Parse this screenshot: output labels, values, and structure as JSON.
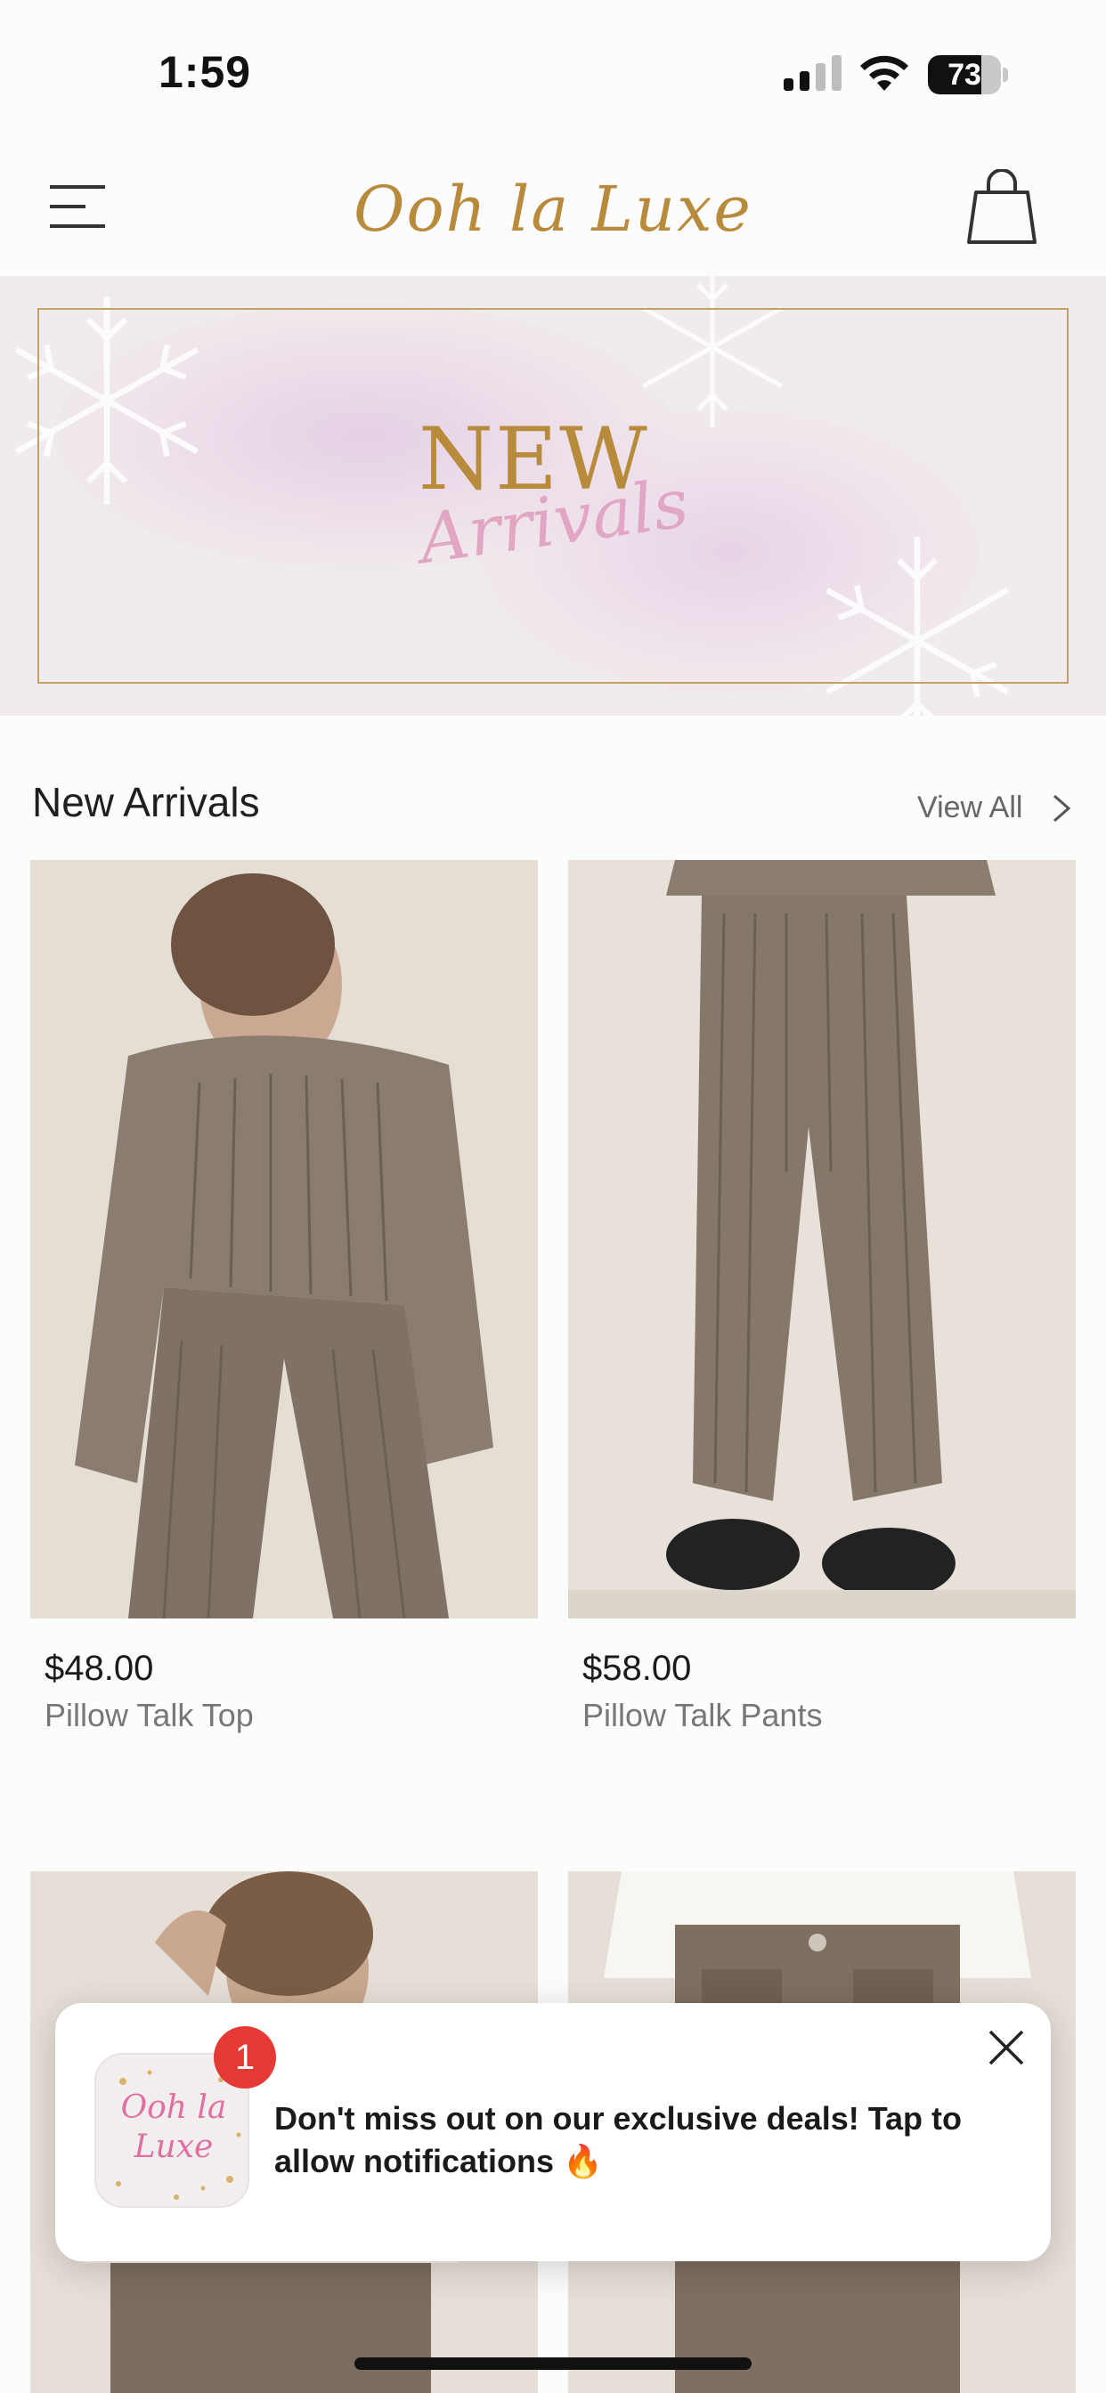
{
  "status_bar": {
    "time": "1:59",
    "battery_level": "73",
    "battery_fraction": 0.73,
    "icons": [
      "signal-icon",
      "wifi-icon",
      "battery-icon"
    ]
  },
  "nav": {
    "logo_text": "Ooh la Luxe",
    "menu_icon": "hamburger-icon",
    "bag_icon": "shopping-bag-icon"
  },
  "banner": {
    "line1": "NEW",
    "line2": "Arrivals"
  },
  "section": {
    "title": "New Arrivals",
    "view_all": "View All"
  },
  "products": [
    {
      "price": "$48.00",
      "name": "Pillow Talk Top"
    },
    {
      "price": "$58.00",
      "name": "Pillow Talk Pants"
    },
    {
      "price": "",
      "name": ""
    },
    {
      "price": "",
      "name": ""
    }
  ],
  "notification": {
    "badge_count": "1",
    "app_icon_text": "Ooh la Luxe",
    "message": "Don't miss out on our exclusive deals! Tap to allow notifications 🔥",
    "close_icon": "close-icon"
  },
  "colors": {
    "accent_gold": "#b88a3b",
    "accent_pink": "#e1a7c2",
    "badge_red": "#e53935",
    "product_bg": "#e4ddd4"
  }
}
